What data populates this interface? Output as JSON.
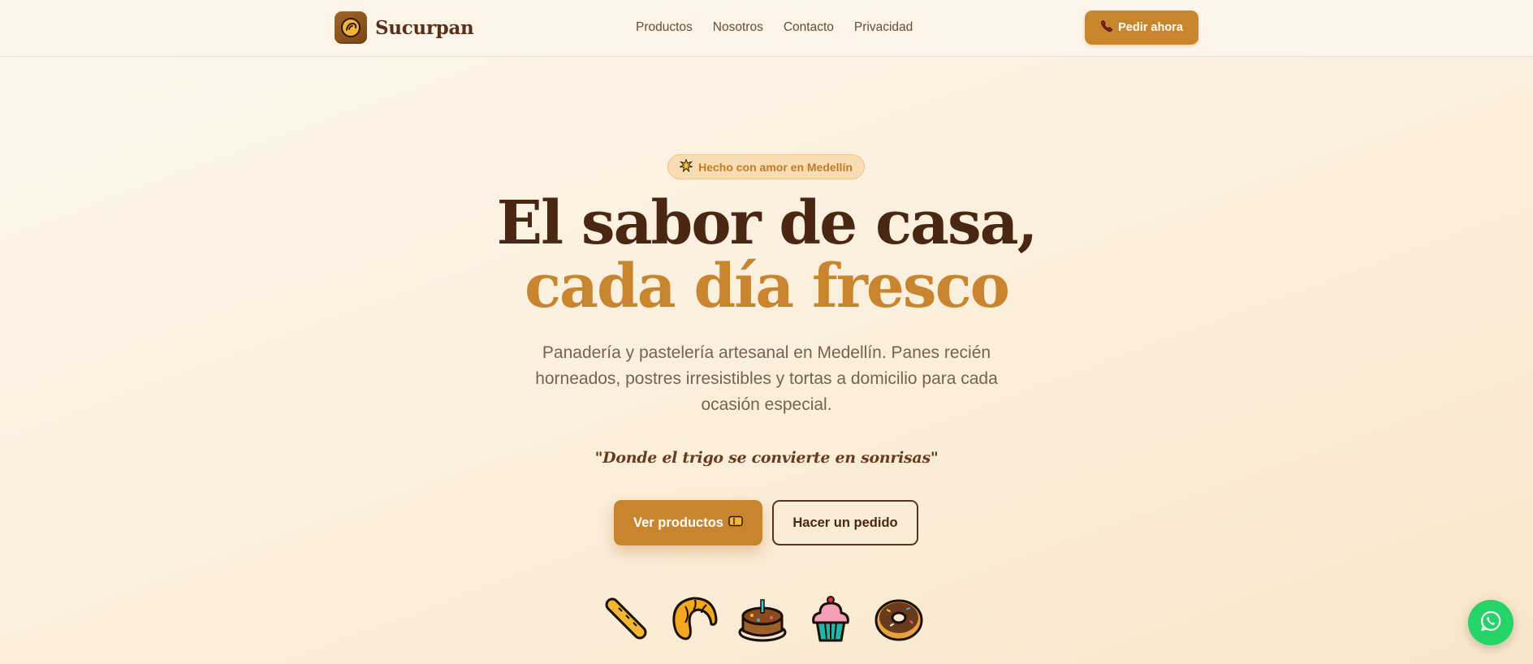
{
  "header": {
    "brand_name": "Sucurpan",
    "nav": [
      {
        "label": "Productos"
      },
      {
        "label": "Nosotros"
      },
      {
        "label": "Contacto"
      },
      {
        "label": "Privacidad"
      }
    ],
    "cta_label": "Pedir ahora",
    "cta_icon": "phone-icon"
  },
  "hero": {
    "badge_text": "Hecho con amor en Medellín",
    "badge_icon": "sparkle-icon",
    "headline_line1": "El sabor de casa,",
    "headline_line2": "cada día fresco",
    "subtitle": "Panadería y pastelería artesanal en Medellín. Panes recién horneados, postres irresistibles y tortas a domicilio para cada ocasión especial.",
    "quote": "\"Donde el trigo se convierte en sonrisas\"",
    "primary_button": "Ver productos",
    "primary_button_icon": "bread-icon",
    "secondary_button": "Hacer un pedido",
    "food_icons": [
      "baguette-icon",
      "croissant-icon",
      "cake-icon",
      "cupcake-icon",
      "donut-icon"
    ]
  },
  "colors": {
    "accent": "#c9852e",
    "brown_dark": "#4a2713",
    "whatsapp": "#25d366"
  },
  "floating": {
    "whatsapp_icon": "whatsapp-icon"
  }
}
